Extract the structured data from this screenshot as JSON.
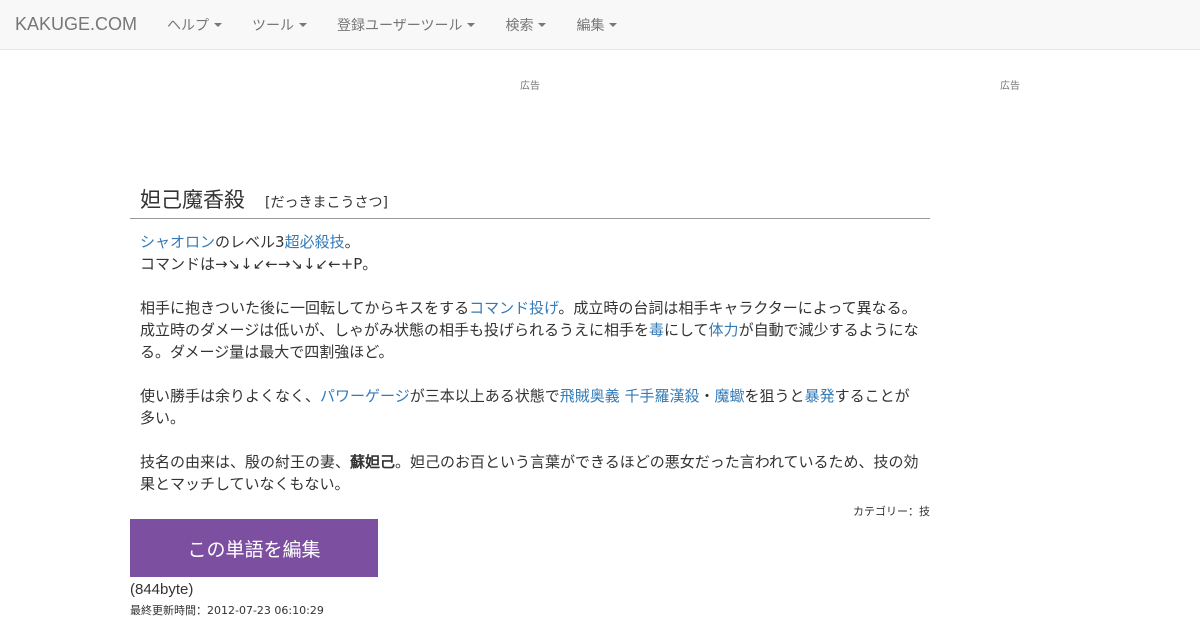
{
  "nav": {
    "brand": "KAKUGE.COM",
    "items": [
      {
        "label": "ヘルプ"
      },
      {
        "label": "ツール"
      },
      {
        "label": "登録ユーザーツール"
      },
      {
        "label": "検索"
      },
      {
        "label": "編集"
      }
    ]
  },
  "ads": {
    "left": "広告",
    "right": "広告"
  },
  "article": {
    "title": "妲己魔香殺",
    "reading": "[だっきまこうさつ]",
    "p1": {
      "l1a": "シャオロン",
      "l1b": "のレベル3",
      "l1c": "超必殺技",
      "l1d": "。",
      "l2": "コマンドは→↘↓↙←→↘↓↙←+P。"
    },
    "p2": {
      "a": "相手に抱きついた後に一回転してからキスをする",
      "b": "コマンド投げ",
      "c": "。成立時の台詞は相手キャラクターによって異なる。",
      "d": "成立時のダメージは低いが、しゃがみ状態の相手も投げられるうえに相手を",
      "e": "毒",
      "f": "にして",
      "g": "体力",
      "h": "が自動で減少するようになる。ダメージ量は最大で四割強ほど。"
    },
    "p3": {
      "a": "使い勝手は余りよくなく、",
      "b": "パワーゲージ",
      "c": "が三本以上ある状態で",
      "d": "飛賊奥義 千手羅漢殺",
      "e": "・",
      "f": "魔蠍",
      "g": "を狙うと",
      "h": "暴発",
      "i": "することが多い。"
    },
    "p4": {
      "a": "技名の由来は、殷の紂王の妻、",
      "b": "蘇妲己",
      "c": "。妲己のお百という言葉ができるほどの悪女だった言われているため、技の効果とマッチしていなくもない。"
    },
    "category": "カテゴリー：技",
    "edit_button": "この単語を編集",
    "size": "(844byte)",
    "updated": "最終更新時間：2012-07-23 06:10:29"
  }
}
